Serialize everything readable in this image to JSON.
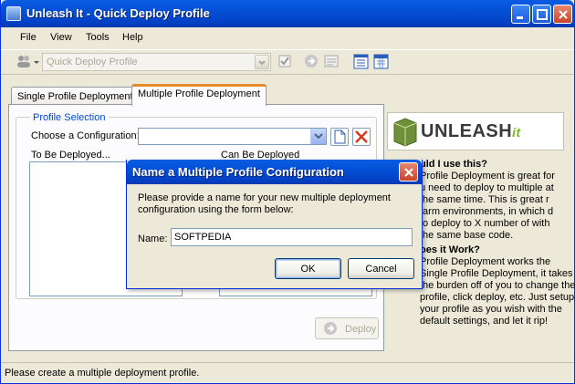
{
  "window": {
    "title": "Unleash It - Quick Deploy Profile"
  },
  "menu": {
    "items": [
      "File",
      "View",
      "Tools",
      "Help"
    ]
  },
  "toolbar": {
    "profile_combo_value": "Quick Deploy Profile"
  },
  "tabs": [
    {
      "label": "Single Profile Deployment"
    },
    {
      "label": "Multiple Profile Deployment"
    }
  ],
  "profile_selection": {
    "legend": "Profile Selection",
    "choose_label": "Choose a Configuration:",
    "to_be_deployed_label": "To Be Deployed...",
    "can_be_deployed_label": "Can Be Deployed"
  },
  "deploy": {
    "label": "Deploy"
  },
  "logo": {
    "text": "UNLEASH",
    "suffix": "it"
  },
  "info": {
    "heading1": "uld I use this?",
    "para1": "Profile Deployment is great for u need to deploy to multiple at the same time. This is great r farm environments, in which d to deploy to X number of with the same base code.",
    "heading2": "oes it Work?",
    "para2": "Profile Deployment works the Single Profile Deployment, it takes the burden off of you to change the profile, click deploy, etc. Just setup your profile as you wish with the default settings, and let it rip!"
  },
  "status": {
    "text": "Please create a multiple deployment profile."
  },
  "dialog": {
    "title": "Name a Multiple Profile Configuration",
    "message": "Please provide a name for your new multiple deployment configuration using the form below:",
    "name_label": "Name:",
    "name_value": "SOFTPEDIA",
    "ok_label": "OK",
    "cancel_label": "Cancel"
  }
}
